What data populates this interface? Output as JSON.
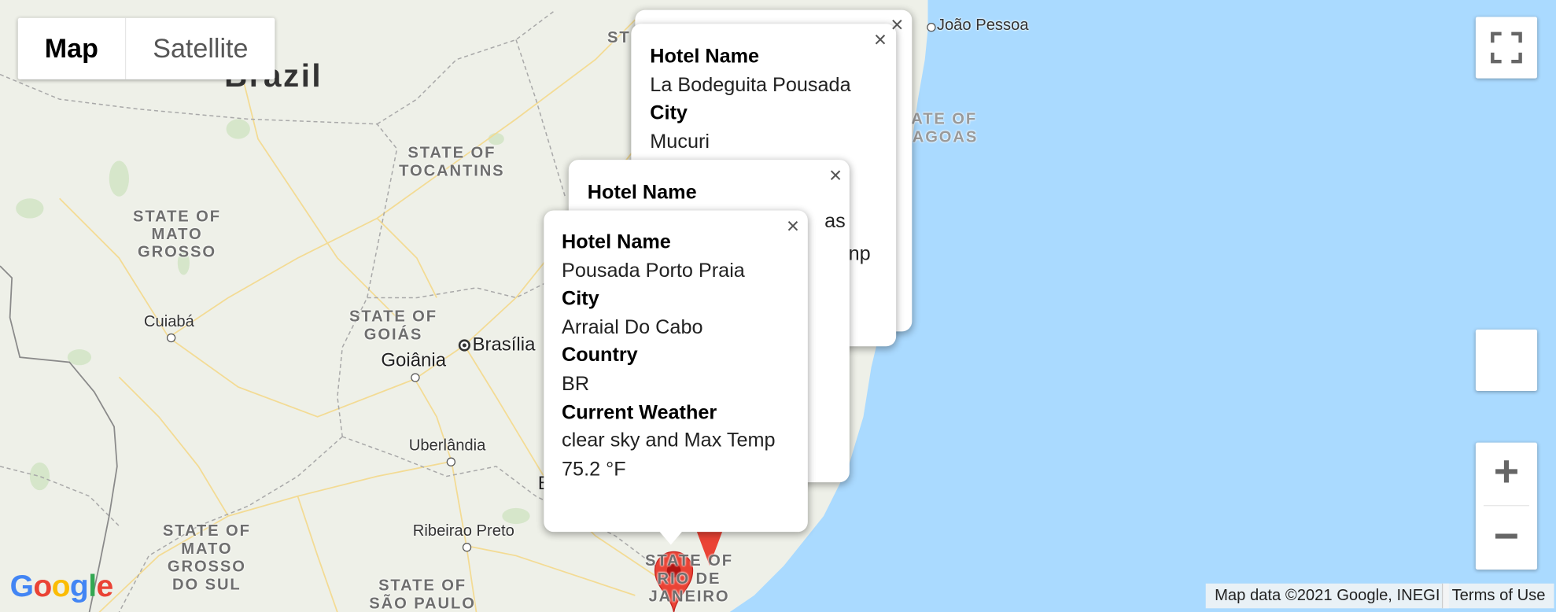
{
  "map": {
    "map_type_control": {
      "map_label": "Map",
      "satellite_label": "Satellite",
      "selected": "Map"
    },
    "country_label": "Brazil",
    "state_labels": {
      "tocantins": [
        "STATE OF",
        "TOCANTINS"
      ],
      "mato_grosso": [
        "STATE OF",
        "MATO",
        "GROSSO"
      ],
      "goias": [
        "STATE OF",
        "GOIÁS"
      ],
      "mato_grosso_do_sul": [
        "STATE OF",
        "MATO",
        "GROSSO",
        "DO SUL"
      ],
      "sao_paulo": [
        "STATE OF",
        "SÃO PAULO"
      ],
      "rio_de_janeiro": [
        "STATE OF",
        "RIO DE",
        "JANEIRO"
      ],
      "alagoas": [
        "STATE OF",
        "ALAGOAS"
      ],
      "top_partial": "ST"
    },
    "city_labels": {
      "joao_pessoa": "João Pessoa",
      "cuiaba": "Cuiabá",
      "brasilia": "Brasília",
      "goiania": "Goiânia",
      "uberlandia": "Uberlândia",
      "ribeirao_preto": "Ribeirao Preto",
      "partial_b": "B"
    },
    "colors": {
      "water": "#aadaff",
      "land": "#eef0e8",
      "marker": "#ea4335",
      "marker_dark": "#b31412",
      "road": "#fbe4a6",
      "border": "#9e9e9e"
    },
    "attribution": {
      "map_data": "Map data ©2021 Google, INEGI",
      "terms": "Terms of Use",
      "logo": "Google"
    }
  },
  "controls": {
    "fullscreen_icon": "fullscreen-icon",
    "zoom_in": "+",
    "zoom_out": "−"
  },
  "info_windows": [
    {
      "fields": [
        {
          "label": "Hotel Name",
          "value": "La Bodeguita Pousada"
        },
        {
          "label": "City",
          "value": "Mucuri"
        }
      ]
    },
    {
      "fields": [
        {
          "label": "Hotel Name",
          "value": ""
        }
      ],
      "partial_line_2": "as",
      "partial_line_4": "np"
    },
    {
      "fields": [
        {
          "label": "Hotel Name",
          "value": "Pousada Porto Praia"
        },
        {
          "label": "City",
          "value": "Arraial Do Cabo"
        },
        {
          "label": "Country",
          "value": "BR"
        },
        {
          "label": "Current Weather",
          "value": "clear sky and Max Temp 75.2 °F"
        }
      ]
    }
  ],
  "close_glyph": "×"
}
